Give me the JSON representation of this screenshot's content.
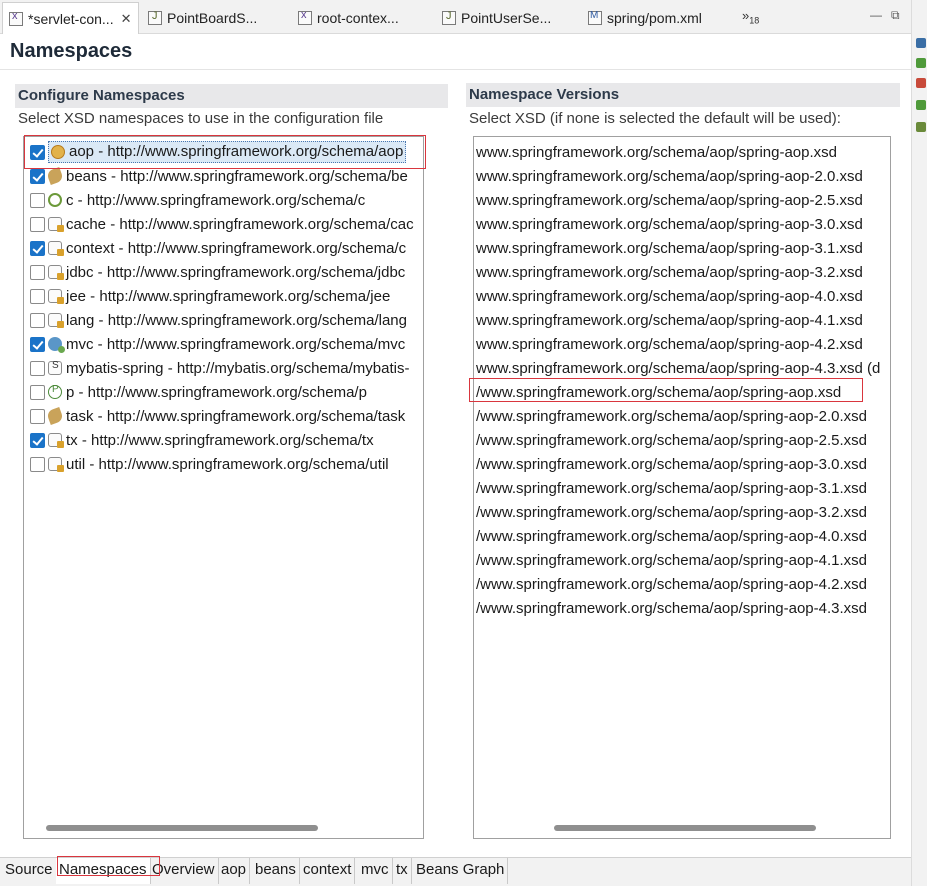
{
  "tabs": [
    {
      "label": "*servlet-con...",
      "icon": "xml-file-icon",
      "active": true,
      "closable": true
    },
    {
      "label": "PointBoardS...",
      "icon": "java-file-icon"
    },
    {
      "label": "root-contex...",
      "icon": "xml-file-icon"
    },
    {
      "label": "PointUserSe...",
      "icon": "java-file-icon"
    },
    {
      "label": "spring/pom.xml",
      "icon": "maven-pom-icon"
    }
  ],
  "tab_overflow": {
    "symbol": "»",
    "count": "18"
  },
  "window_controls": {
    "minimize": "—",
    "maximize": "⧉"
  },
  "page_title": "Namespaces",
  "configure": {
    "header": "Configure Namespaces",
    "description": "Select XSD namespaces to use in the configuration file",
    "items": [
      {
        "label": "aop - http://www.springframework.org/schema/aop",
        "checked": true,
        "icon": "aop-namespace-icon",
        "selected": true
      },
      {
        "label": "beans - http://www.springframework.org/schema/be",
        "checked": true,
        "icon": "beans-namespace-icon"
      },
      {
        "label": "c - http://www.springframework.org/schema/c",
        "checked": false,
        "icon": "c-namespace-icon"
      },
      {
        "label": "cache - http://www.springframework.org/schema/cac",
        "checked": false,
        "icon": "cache-namespace-icon"
      },
      {
        "label": "context - http://www.springframework.org/schema/c",
        "checked": true,
        "icon": "context-namespace-icon"
      },
      {
        "label": "jdbc - http://www.springframework.org/schema/jdbc",
        "checked": false,
        "icon": "jdbc-namespace-icon"
      },
      {
        "label": "jee - http://www.springframework.org/schema/jee",
        "checked": false,
        "icon": "jee-namespace-icon"
      },
      {
        "label": "lang - http://www.springframework.org/schema/lang",
        "checked": false,
        "icon": "lang-namespace-icon"
      },
      {
        "label": "mvc - http://www.springframework.org/schema/mvc",
        "checked": true,
        "icon": "mvc-namespace-icon"
      },
      {
        "label": "mybatis-spring - http://mybatis.org/schema/mybatis-",
        "checked": false,
        "icon": "mybatis-namespace-icon"
      },
      {
        "label": "p - http://www.springframework.org/schema/p",
        "checked": false,
        "icon": "p-namespace-icon"
      },
      {
        "label": "task - http://www.springframework.org/schema/task",
        "checked": false,
        "icon": "task-namespace-icon"
      },
      {
        "label": "tx - http://www.springframework.org/schema/tx",
        "checked": true,
        "icon": "tx-namespace-icon"
      },
      {
        "label": "util - http://www.springframework.org/schema/util",
        "checked": false,
        "icon": "util-namespace-icon"
      }
    ]
  },
  "versions": {
    "header": "Namespace Versions",
    "description": "Select XSD (if none is selected the default will be used):",
    "items": [
      "www.springframework.org/schema/aop/spring-aop.xsd",
      "www.springframework.org/schema/aop/spring-aop-2.0.xsd",
      "www.springframework.org/schema/aop/spring-aop-2.5.xsd",
      "www.springframework.org/schema/aop/spring-aop-3.0.xsd",
      "www.springframework.org/schema/aop/spring-aop-3.1.xsd",
      "www.springframework.org/schema/aop/spring-aop-3.2.xsd",
      "www.springframework.org/schema/aop/spring-aop-4.0.xsd",
      "www.springframework.org/schema/aop/spring-aop-4.1.xsd",
      "www.springframework.org/schema/aop/spring-aop-4.2.xsd",
      "www.springframework.org/schema/aop/spring-aop-4.3.xsd (d",
      "/www.springframework.org/schema/aop/spring-aop.xsd",
      "/www.springframework.org/schema/aop/spring-aop-2.0.xsd",
      "/www.springframework.org/schema/aop/spring-aop-2.5.xsd",
      "/www.springframework.org/schema/aop/spring-aop-3.0.xsd",
      "/www.springframework.org/schema/aop/spring-aop-3.1.xsd",
      "/www.springframework.org/schema/aop/spring-aop-3.2.xsd",
      "/www.springframework.org/schema/aop/spring-aop-4.0.xsd",
      "/www.springframework.org/schema/aop/spring-aop-4.1.xsd",
      "/www.springframework.org/schema/aop/spring-aop-4.2.xsd",
      "/www.springframework.org/schema/aop/spring-aop-4.3.xsd"
    ]
  },
  "bottom_tabs": [
    "Source",
    "Namespaces",
    "Overview",
    "aop",
    "beans",
    "context",
    "mvc",
    "tx",
    "Beans Graph"
  ],
  "active_bottom_tab": "Namespaces",
  "colors": {
    "highlight_box": "#d9363e",
    "checkbox_checked": "#1a73c8"
  }
}
